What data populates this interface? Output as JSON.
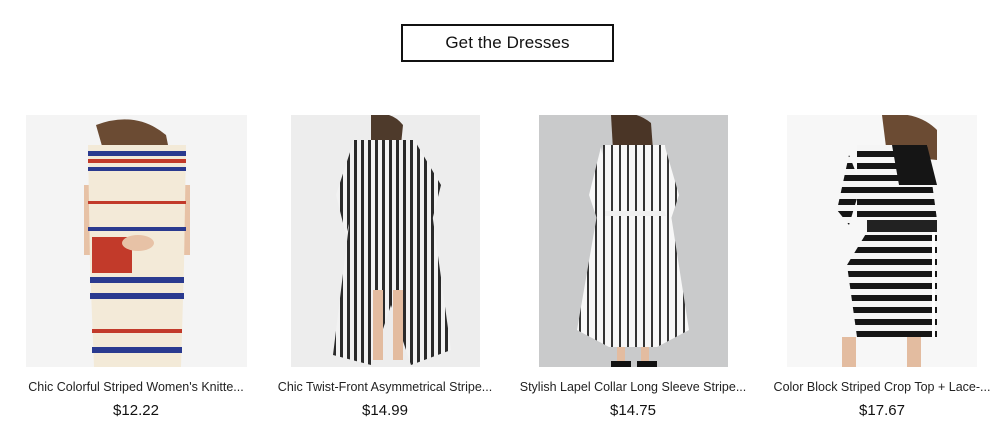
{
  "cta": {
    "label": "Get the Dresses"
  },
  "products": [
    {
      "name": "Chic Colorful Striped Women's Knitte...",
      "price": "$12.22"
    },
    {
      "name": "Chic Twist-Front Asymmetrical Stripe...",
      "price": "$14.99"
    },
    {
      "name": "Stylish Lapel Collar Long Sleeve Stripe...",
      "price": "$14.75"
    },
    {
      "name": "Color Block Striped Crop Top + Lace-...",
      "price": "$17.67"
    }
  ]
}
